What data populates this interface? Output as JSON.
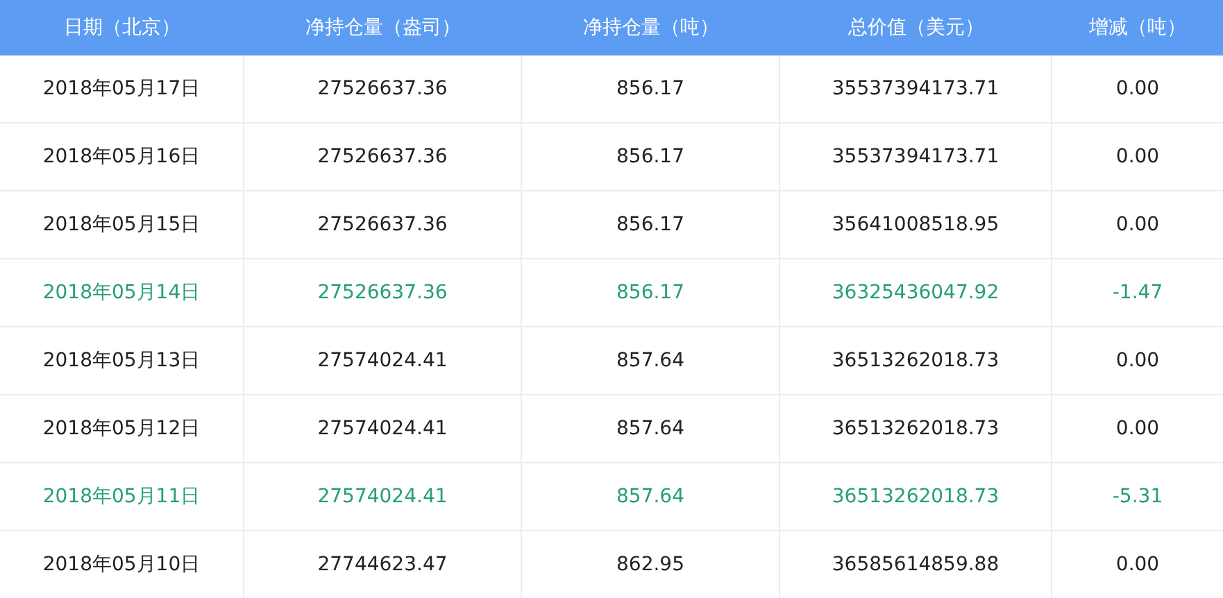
{
  "table": {
    "columns": [
      "日期（北京）",
      "净持仓量（盎司）",
      "净持仓量（吨）",
      "总价值（美元）",
      "增减（吨）"
    ],
    "rows": [
      {
        "cells": [
          "2018年05月17日",
          "27526637.36",
          "856.17",
          "35537394173.71",
          "0.00"
        ],
        "highlighted": false
      },
      {
        "cells": [
          "2018年05月16日",
          "27526637.36",
          "856.17",
          "35537394173.71",
          "0.00"
        ],
        "highlighted": false
      },
      {
        "cells": [
          "2018年05月15日",
          "27526637.36",
          "856.17",
          "35641008518.95",
          "0.00"
        ],
        "highlighted": false
      },
      {
        "cells": [
          "2018年05月14日",
          "27526637.36",
          "856.17",
          "36325436047.92",
          "-1.47"
        ],
        "highlighted": true
      },
      {
        "cells": [
          "2018年05月13日",
          "27574024.41",
          "857.64",
          "36513262018.73",
          "0.00"
        ],
        "highlighted": false
      },
      {
        "cells": [
          "2018年05月12日",
          "27574024.41",
          "857.64",
          "36513262018.73",
          "0.00"
        ],
        "highlighted": false
      },
      {
        "cells": [
          "2018年05月11日",
          "27574024.41",
          "857.64",
          "36513262018.73",
          "-5.31"
        ],
        "highlighted": true
      },
      {
        "cells": [
          "2018年05月10日",
          "27744623.47",
          "862.95",
          "36585614859.88",
          "0.00"
        ],
        "highlighted": false
      }
    ]
  }
}
